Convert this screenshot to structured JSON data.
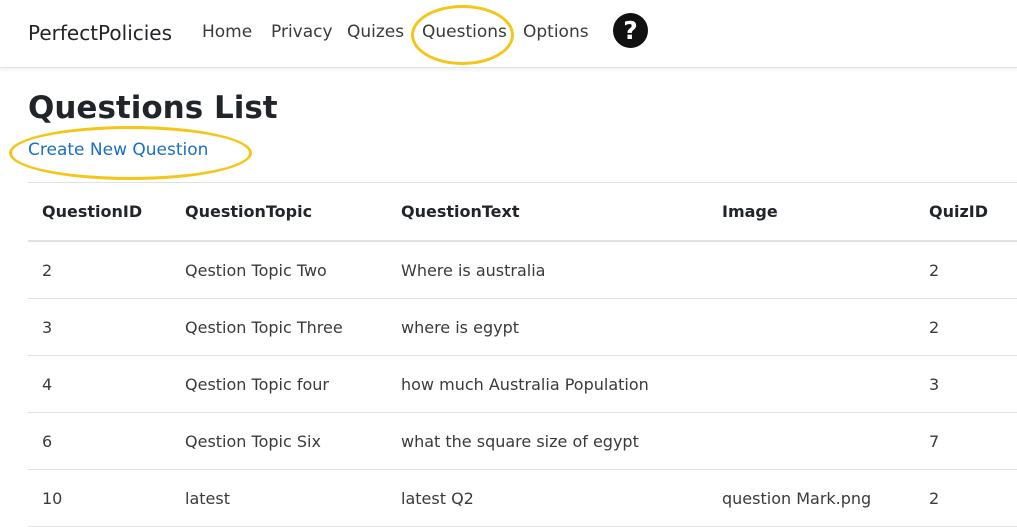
{
  "navbar": {
    "brand": "PerfectPolicies",
    "links": [
      "Home",
      "Privacy",
      "Quizes",
      "Questions",
      "Options"
    ],
    "help_icon": "question-mark-circle-icon"
  },
  "page": {
    "title": "Questions List",
    "create_link": "Create New Question"
  },
  "highlight_color": "#f5c518",
  "link_color": "#1b6ec2",
  "table": {
    "headers": [
      "QuestionID",
      "QuestionTopic",
      "QuestionText",
      "Image",
      "QuizID"
    ],
    "rows": [
      [
        "2",
        "Qestion Topic Two",
        "Where is australia",
        "",
        "2"
      ],
      [
        "3",
        "Qestion Topic Three",
        "where is egypt",
        "",
        "2"
      ],
      [
        "4",
        "Qestion Topic four",
        "how much Australia Population",
        "",
        "3"
      ],
      [
        "6",
        "Qestion Topic Six",
        "what the square size of egypt",
        "",
        "7"
      ],
      [
        "10",
        "latest",
        "latest Q2",
        "question Mark.png",
        "2"
      ]
    ]
  }
}
